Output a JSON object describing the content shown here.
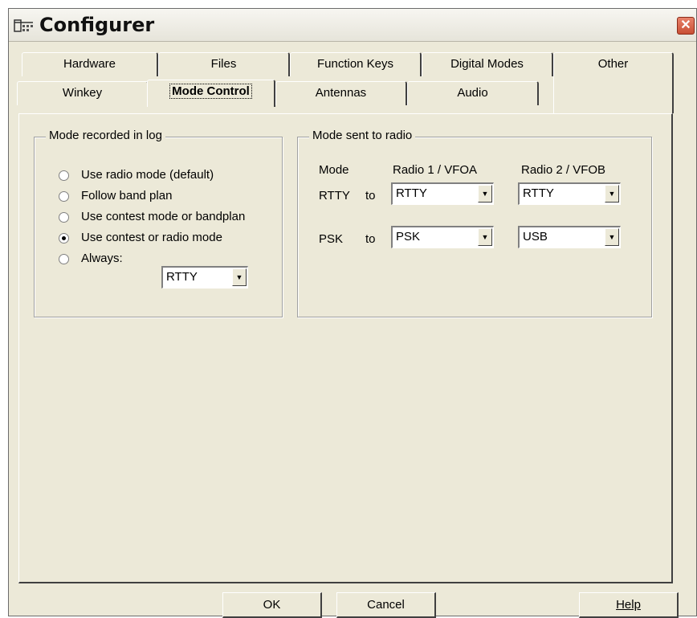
{
  "window": {
    "title": "Configurer",
    "close_symbol": "✕"
  },
  "tabs": {
    "back_row": [
      "Hardware",
      "Files",
      "Function Keys",
      "Digital Modes",
      "Other"
    ],
    "front_row": [
      "Winkey",
      "Mode Control",
      "Antennas",
      "Audio"
    ],
    "active": "Mode Control"
  },
  "mode_log": {
    "group_label": "Mode recorded in log",
    "options": [
      {
        "label": "Use radio mode (default)",
        "checked": false
      },
      {
        "label": "Follow band plan",
        "checked": false
      },
      {
        "label": "Use contest mode or bandplan",
        "checked": false
      },
      {
        "label": "Use contest or radio mode",
        "checked": true
      },
      {
        "label": "Always:",
        "checked": false
      }
    ],
    "always_value": "RTTY"
  },
  "mode_radio": {
    "group_label": "Mode sent to radio",
    "col_mode": "Mode",
    "col_radio1": "Radio 1 / VFOA",
    "col_radio2": "Radio 2 / VFOB",
    "rows": [
      {
        "label": "RTTY",
        "to": "to",
        "radio1": "RTTY",
        "radio2": "RTTY"
      },
      {
        "label": "PSK",
        "to": "to",
        "radio1": "PSK",
        "radio2": "USB"
      }
    ]
  },
  "buttons": {
    "ok": "OK",
    "cancel": "Cancel",
    "help": "Help"
  },
  "icons": {
    "combo_arrow": "chevron-down-icon",
    "app": "configurer-app-icon"
  }
}
